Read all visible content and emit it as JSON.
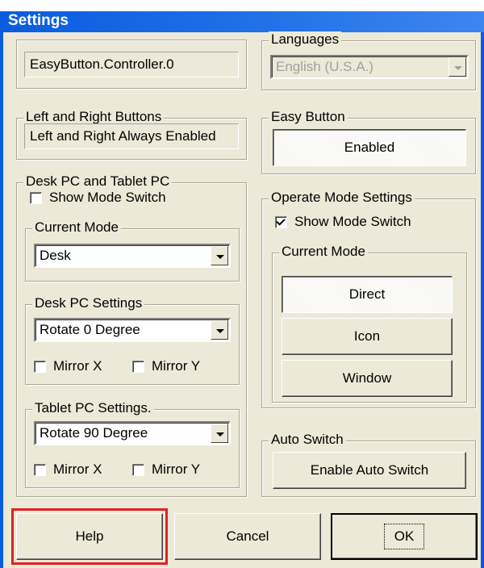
{
  "window": {
    "title": "Settings"
  },
  "controller": {
    "value": "EasyButton.Controller.0"
  },
  "languages": {
    "label": "Languages",
    "selected": "English (U.S.A.)"
  },
  "left_right": {
    "label": "Left and Right Buttons",
    "value": "Left and Right Always Enabled"
  },
  "easy_button": {
    "label": "Easy Button",
    "button": "Enabled"
  },
  "desk_tablet": {
    "label": "Desk PC and Tablet PC",
    "show_mode_switch": "Show Mode Switch",
    "current_mode": {
      "label": "Current Mode",
      "selected": "Desk"
    },
    "desk_settings": {
      "label": "Desk PC Settings",
      "selected": "Rotate 0 Degree",
      "mirror_x": "Mirror X",
      "mirror_y": "Mirror Y"
    },
    "tablet_settings": {
      "label": "Tablet PC Settings.",
      "selected": "Rotate 90 Degree",
      "mirror_x": "Mirror X",
      "mirror_y": "Mirror Y"
    }
  },
  "operate_mode": {
    "label": "Operate Mode Settings",
    "show_mode_switch": "Show Mode Switch",
    "current_mode_label": "Current Mode",
    "modes": [
      "Direct",
      "Icon",
      "Window"
    ]
  },
  "auto_switch": {
    "label": "Auto Switch",
    "button": "Enable Auto Switch"
  },
  "footer": {
    "help": "Help",
    "cancel": "Cancel",
    "ok": "OK"
  }
}
